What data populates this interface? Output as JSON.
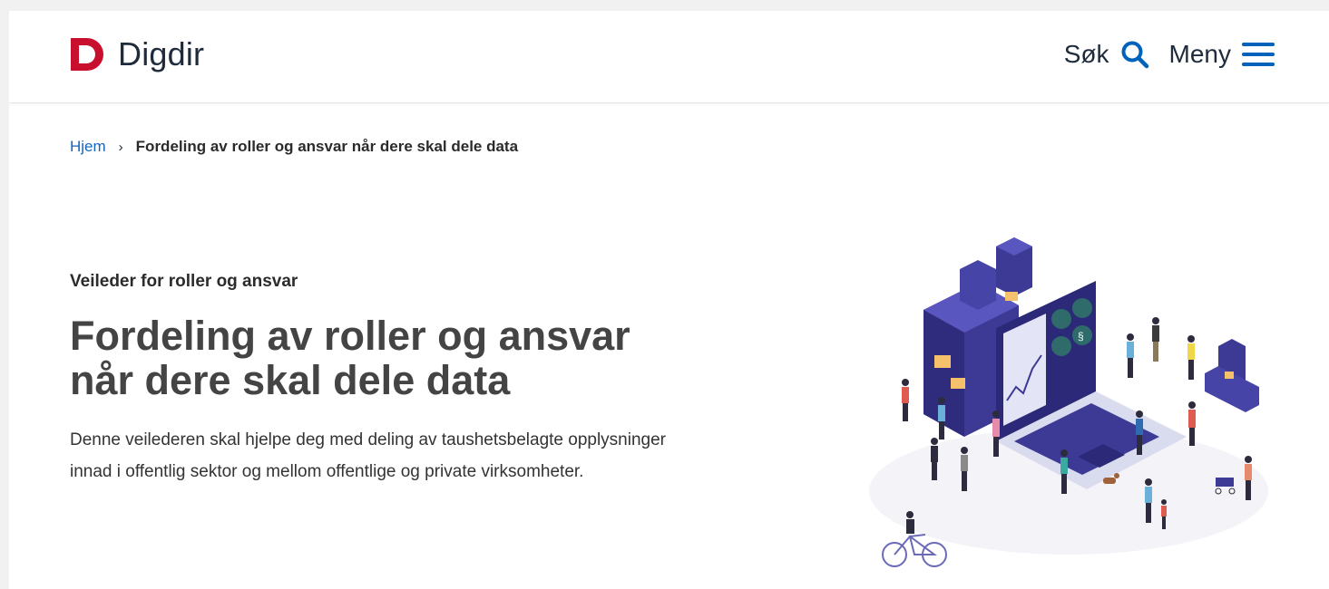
{
  "header": {
    "logo_text": "Digdir",
    "search_label": "Søk",
    "menu_label": "Meny",
    "brand_color": "#c8102e",
    "accent_color": "#0062ba"
  },
  "breadcrumb": {
    "home": "Hjem",
    "current": "Fordeling av roller og ansvar når dere skal dele data"
  },
  "main": {
    "eyebrow": "Veileder for roller og ansvar",
    "title_line1": "Fordeling av roller og ansvar",
    "title_line2": "når dere skal dele data",
    "lead": "Denne veilederen skal hjelpe deg med deling av taushetsbelagte opplysninger innad i offentlig sektor og mellom offentlige og private virksomheter."
  },
  "illustration": {
    "icon": "isometric-data-sharing-illustration",
    "screen_symbol": "§"
  }
}
